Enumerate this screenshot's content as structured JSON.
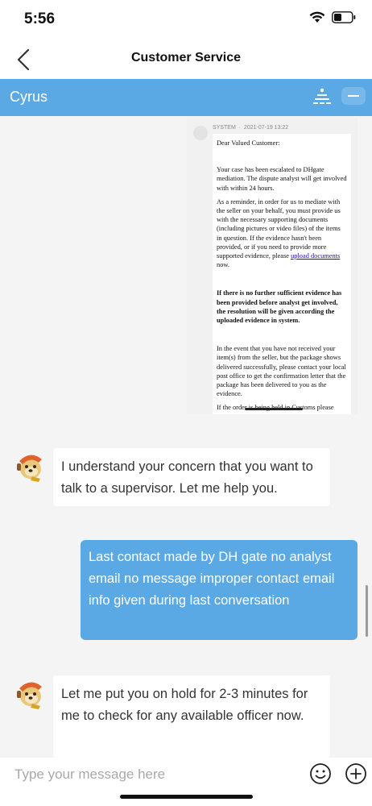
{
  "status_bar": {
    "time": "5:56",
    "icons": [
      "signal-icon",
      "wifi-icon",
      "battery-icon"
    ]
  },
  "nav": {
    "title": "Customer Service",
    "back_icon": "chevron-left-icon"
  },
  "agent_bar": {
    "name": "Cyrus",
    "queue_icon": "queue-icon",
    "collapse_icon": "minus-icon"
  },
  "screenshot_message": {
    "sender": "SYSTEM",
    "timestamp": "2021-07-19 13:22",
    "greeting": "Dear Valued Customer:",
    "para1": "Your case has been escalated to DHgate mediation. The dispute analyst will get involved with within 24 hours.",
    "para2_before": "As a reminder, in order for us to mediate with the seller on your behalf, you must provide us with the necessary supporting documents (including pictures or video files) of the items in question. If the evidence hasn't been provided, or if you need to provide more supported evidence, please",
    "para2_link": "upload documents",
    "para2_after": "now.",
    "para3_bold": "If there is no further sufficient evidence has been provided before analyst get involved, the resolution will be given according the uploaded evidence in system.",
    "para4": "In the event that you have not received your item(s) from the seller, but the package shows delivered successfully, please contact your local post office to get the confirmation letter that the package has been delivered to you as the evidence.",
    "para5_partial": "If the order is being held in Customs please"
  },
  "messages": [
    {
      "sender": "agent",
      "text": "I understand your concern that you want to talk to a supervisor. Let me help you."
    },
    {
      "sender": "user",
      "text": "Last contact made by DH gate no analyst email no message improper contact email info given during last conversation"
    },
    {
      "sender": "agent",
      "text": "Let me put you on hold for 2-3 minutes for me to check for any available officer now."
    }
  ],
  "input": {
    "placeholder": "Type your message here",
    "value": ""
  },
  "colors": {
    "accent": "#5aa9e4",
    "background": "#f4f4f4",
    "bubble_in": "#ffffff",
    "text": "#333333"
  }
}
